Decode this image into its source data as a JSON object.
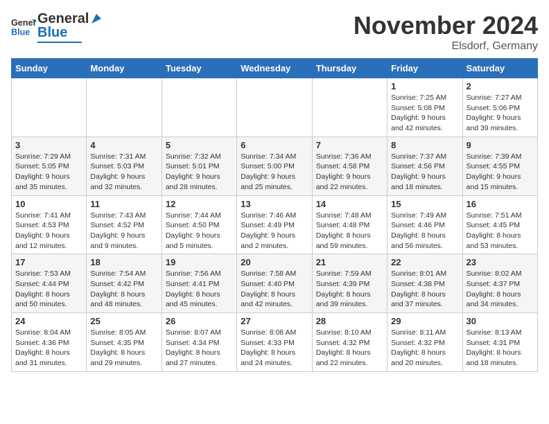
{
  "header": {
    "logo_general": "General",
    "logo_blue": "Blue",
    "month_title": "November 2024",
    "location": "Elsdorf, Germany"
  },
  "weekdays": [
    "Sunday",
    "Monday",
    "Tuesday",
    "Wednesday",
    "Thursday",
    "Friday",
    "Saturday"
  ],
  "weeks": [
    [
      {
        "day": "",
        "info": ""
      },
      {
        "day": "",
        "info": ""
      },
      {
        "day": "",
        "info": ""
      },
      {
        "day": "",
        "info": ""
      },
      {
        "day": "",
        "info": ""
      },
      {
        "day": "1",
        "info": "Sunrise: 7:25 AM\nSunset: 5:08 PM\nDaylight: 9 hours\nand 42 minutes."
      },
      {
        "day": "2",
        "info": "Sunrise: 7:27 AM\nSunset: 5:06 PM\nDaylight: 9 hours\nand 39 minutes."
      }
    ],
    [
      {
        "day": "3",
        "info": "Sunrise: 7:29 AM\nSunset: 5:05 PM\nDaylight: 9 hours\nand 35 minutes."
      },
      {
        "day": "4",
        "info": "Sunrise: 7:31 AM\nSunset: 5:03 PM\nDaylight: 9 hours\nand 32 minutes."
      },
      {
        "day": "5",
        "info": "Sunrise: 7:32 AM\nSunset: 5:01 PM\nDaylight: 9 hours\nand 28 minutes."
      },
      {
        "day": "6",
        "info": "Sunrise: 7:34 AM\nSunset: 5:00 PM\nDaylight: 9 hours\nand 25 minutes."
      },
      {
        "day": "7",
        "info": "Sunrise: 7:36 AM\nSunset: 4:58 PM\nDaylight: 9 hours\nand 22 minutes."
      },
      {
        "day": "8",
        "info": "Sunrise: 7:37 AM\nSunset: 4:56 PM\nDaylight: 9 hours\nand 18 minutes."
      },
      {
        "day": "9",
        "info": "Sunrise: 7:39 AM\nSunset: 4:55 PM\nDaylight: 9 hours\nand 15 minutes."
      }
    ],
    [
      {
        "day": "10",
        "info": "Sunrise: 7:41 AM\nSunset: 4:53 PM\nDaylight: 9 hours\nand 12 minutes."
      },
      {
        "day": "11",
        "info": "Sunrise: 7:43 AM\nSunset: 4:52 PM\nDaylight: 9 hours\nand 9 minutes."
      },
      {
        "day": "12",
        "info": "Sunrise: 7:44 AM\nSunset: 4:50 PM\nDaylight: 9 hours\nand 5 minutes."
      },
      {
        "day": "13",
        "info": "Sunrise: 7:46 AM\nSunset: 4:49 PM\nDaylight: 9 hours\nand 2 minutes."
      },
      {
        "day": "14",
        "info": "Sunrise: 7:48 AM\nSunset: 4:48 PM\nDaylight: 8 hours\nand 59 minutes."
      },
      {
        "day": "15",
        "info": "Sunrise: 7:49 AM\nSunset: 4:46 PM\nDaylight: 8 hours\nand 56 minutes."
      },
      {
        "day": "16",
        "info": "Sunrise: 7:51 AM\nSunset: 4:45 PM\nDaylight: 8 hours\nand 53 minutes."
      }
    ],
    [
      {
        "day": "17",
        "info": "Sunrise: 7:53 AM\nSunset: 4:44 PM\nDaylight: 8 hours\nand 50 minutes."
      },
      {
        "day": "18",
        "info": "Sunrise: 7:54 AM\nSunset: 4:42 PM\nDaylight: 8 hours\nand 48 minutes."
      },
      {
        "day": "19",
        "info": "Sunrise: 7:56 AM\nSunset: 4:41 PM\nDaylight: 8 hours\nand 45 minutes."
      },
      {
        "day": "20",
        "info": "Sunrise: 7:58 AM\nSunset: 4:40 PM\nDaylight: 8 hours\nand 42 minutes."
      },
      {
        "day": "21",
        "info": "Sunrise: 7:59 AM\nSunset: 4:39 PM\nDaylight: 8 hours\nand 39 minutes."
      },
      {
        "day": "22",
        "info": "Sunrise: 8:01 AM\nSunset: 4:38 PM\nDaylight: 8 hours\nand 37 minutes."
      },
      {
        "day": "23",
        "info": "Sunrise: 8:02 AM\nSunset: 4:37 PM\nDaylight: 8 hours\nand 34 minutes."
      }
    ],
    [
      {
        "day": "24",
        "info": "Sunrise: 8:04 AM\nSunset: 4:36 PM\nDaylight: 8 hours\nand 31 minutes."
      },
      {
        "day": "25",
        "info": "Sunrise: 8:05 AM\nSunset: 4:35 PM\nDaylight: 8 hours\nand 29 minutes."
      },
      {
        "day": "26",
        "info": "Sunrise: 8:07 AM\nSunset: 4:34 PM\nDaylight: 8 hours\nand 27 minutes."
      },
      {
        "day": "27",
        "info": "Sunrise: 8:08 AM\nSunset: 4:33 PM\nDaylight: 8 hours\nand 24 minutes."
      },
      {
        "day": "28",
        "info": "Sunrise: 8:10 AM\nSunset: 4:32 PM\nDaylight: 8 hours\nand 22 minutes."
      },
      {
        "day": "29",
        "info": "Sunrise: 8:11 AM\nSunset: 4:32 PM\nDaylight: 8 hours\nand 20 minutes."
      },
      {
        "day": "30",
        "info": "Sunrise: 8:13 AM\nSunset: 4:31 PM\nDaylight: 8 hours\nand 18 minutes."
      }
    ]
  ]
}
